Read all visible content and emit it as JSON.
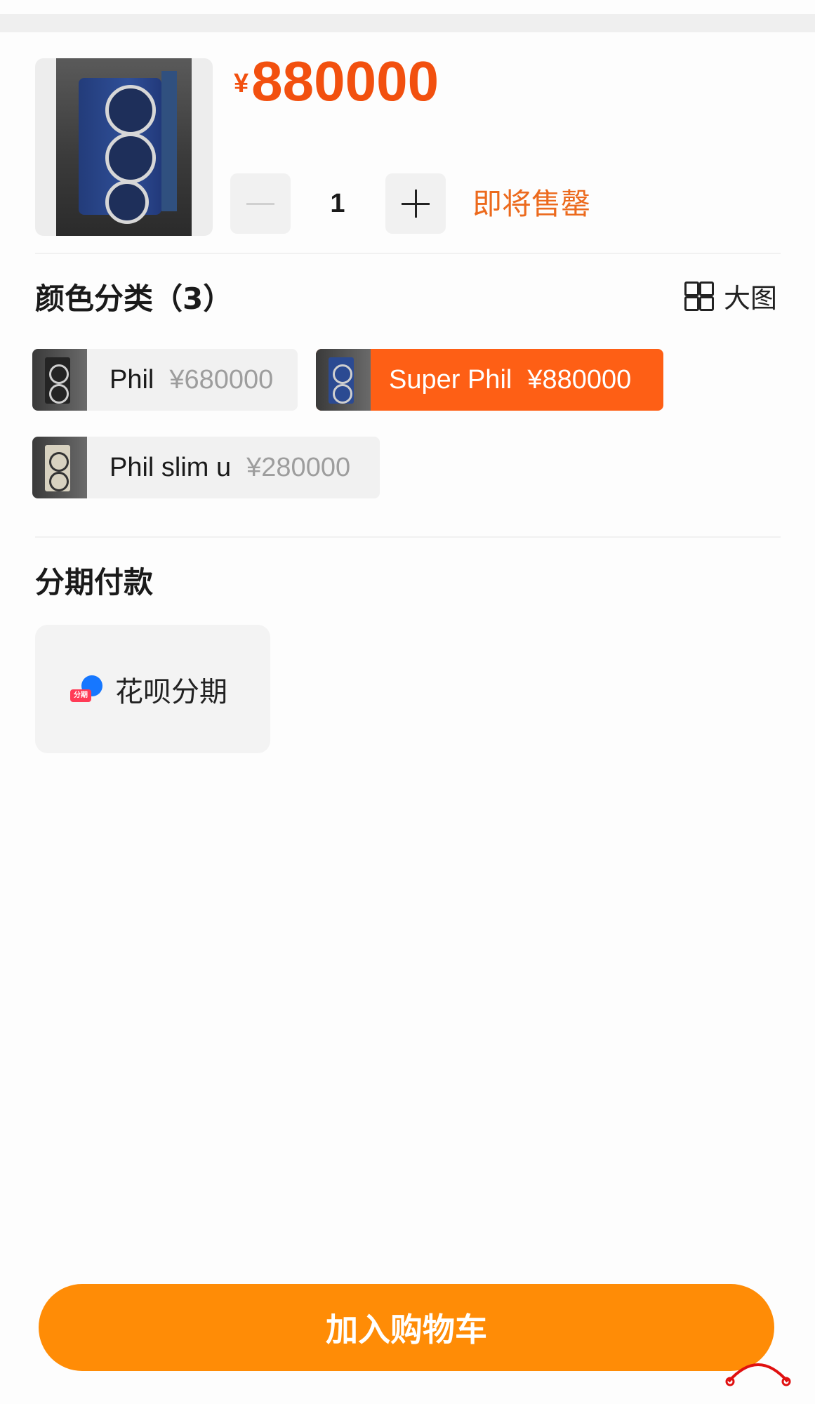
{
  "product": {
    "price_symbol": "¥",
    "price": "880000",
    "quantity": "1",
    "stock_status": "即将售罄"
  },
  "variants_section": {
    "title": "颜色分类（3）",
    "big_image_label": "大图",
    "items": [
      {
        "name": "Phil",
        "price": "¥680000",
        "selected": false
      },
      {
        "name": "Super Phil",
        "price": "¥880000",
        "selected": true
      },
      {
        "name": "Phil slim u",
        "price": "¥280000",
        "selected": false
      }
    ]
  },
  "installment_section": {
    "title": "分期付款",
    "option_label": "花呗分期",
    "option_icon_tag": "分期"
  },
  "cart_button": {
    "label": "加入购物车"
  },
  "colors": {
    "accent_orange": "#ff8c06",
    "price_red": "#f2500f",
    "selected_variant": "#fe5f15",
    "huabei_blue": "#1677ff"
  }
}
